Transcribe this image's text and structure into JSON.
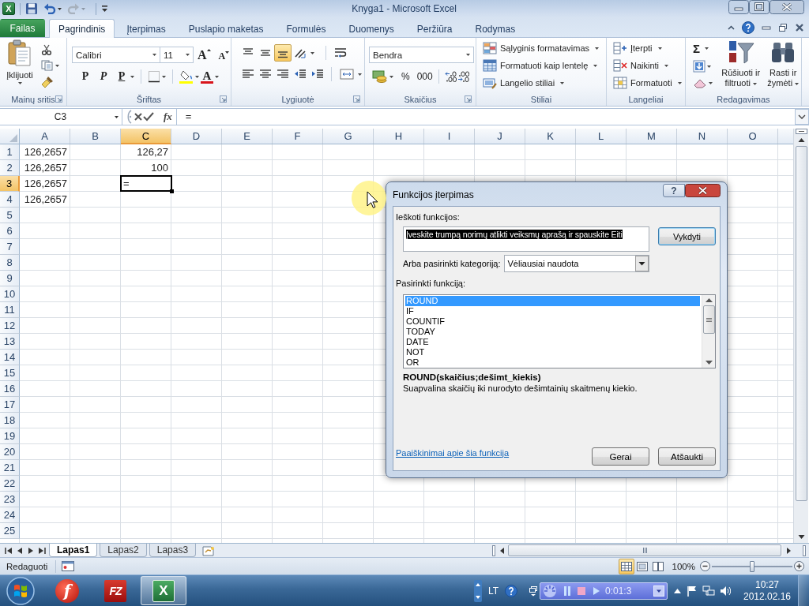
{
  "window": {
    "app_glyph": "X",
    "title": "Knyga1 - Microsoft Excel"
  },
  "quick_access": [
    {
      "kind": "save",
      "disabled": false
    },
    {
      "kind": "undo",
      "disabled": false
    },
    {
      "kind": "redo",
      "disabled": true
    }
  ],
  "ribbon_tabs": [
    {
      "label": "Failas",
      "kind": "file",
      "selected": false
    },
    {
      "label": "Pagrindinis",
      "kind": "tab",
      "selected": true
    },
    {
      "label": "Įterpimas",
      "kind": "tab",
      "selected": false
    },
    {
      "label": "Puslapio maketas",
      "kind": "tab",
      "selected": false
    },
    {
      "label": "Formulės",
      "kind": "tab",
      "selected": false
    },
    {
      "label": "Duomenys",
      "kind": "tab",
      "selected": false
    },
    {
      "label": "Peržiūra",
      "kind": "tab",
      "selected": false
    },
    {
      "label": "Rodymas",
      "kind": "tab",
      "selected": false
    }
  ],
  "ribbon": {
    "clipboard": {
      "label": "Mainų sritis",
      "paste": "Įklijuoti"
    },
    "font": {
      "label": "Šriftas",
      "font_name": "Calibri",
      "font_size": "11",
      "grow": "A",
      "shrink": "A",
      "styles": [
        {
          "label": "P",
          "kind": "bold"
        },
        {
          "label": "P",
          "kind": "italic"
        },
        {
          "label": "P",
          "kind": "underline"
        }
      ],
      "font_color": "A"
    },
    "alignment": {
      "label": "Lygiuotė",
      "vertical": [
        {
          "kind": "top",
          "selected": false
        },
        {
          "kind": "middle",
          "selected": false
        },
        {
          "kind": "bottom",
          "selected": true
        }
      ],
      "horizontal": [
        {
          "kind": "left",
          "selected": false
        },
        {
          "kind": "center",
          "selected": false
        },
        {
          "kind": "right",
          "selected": false
        }
      ]
    },
    "number": {
      "label": "Skaičius",
      "format": "Bendra",
      "percent": "%",
      "thousands": "000"
    },
    "styles": {
      "label": "Stiliai",
      "commands": [
        {
          "label": "Sąlyginis formatavimas",
          "kind": "conditional"
        },
        {
          "label": "Formatuoti kaip lentelę",
          "kind": "table"
        },
        {
          "label": "Langelio stiliai",
          "kind": "cell"
        }
      ]
    },
    "cells": {
      "label": "Langeliai",
      "commands": [
        {
          "label": "Įterpti",
          "kind": "insert"
        },
        {
          "label": "Naikinti",
          "kind": "delete"
        },
        {
          "label": "Formatuoti",
          "kind": "format"
        }
      ]
    },
    "editing": {
      "label": "Redagavimas",
      "sum": "Σ",
      "sort": "Rūšiuoti ir filtruoti",
      "find": "Rasti ir žymėti"
    }
  },
  "formula_bar": {
    "name_box": "C3",
    "insert_function": "fx",
    "formula": "="
  },
  "sheet": {
    "columns": [
      {
        "label": "A",
        "selected": false
      },
      {
        "label": "B",
        "selected": false
      },
      {
        "label": "C",
        "selected": true
      },
      {
        "label": "D",
        "selected": false
      },
      {
        "label": "E",
        "selected": false
      },
      {
        "label": "F",
        "selected": false
      },
      {
        "label": "G",
        "selected": false
      },
      {
        "label": "H",
        "selected": false
      },
      {
        "label": "I",
        "selected": false
      },
      {
        "label": "J",
        "selected": false
      },
      {
        "label": "K",
        "selected": false
      },
      {
        "label": "L",
        "selected": false
      },
      {
        "label": "M",
        "selected": false
      },
      {
        "label": "N",
        "selected": false
      },
      {
        "label": "O",
        "selected": false
      }
    ],
    "rows": [
      {
        "label": "1",
        "selected": false,
        "cells": [
          {
            "text": "126,2657",
            "kind": "number",
            "selected": false
          },
          null,
          {
            "text": "126,27",
            "kind": "number",
            "selected": false
          }
        ]
      },
      {
        "label": "2",
        "selected": false,
        "cells": [
          {
            "text": "126,2657",
            "kind": "number",
            "selected": false
          },
          null,
          {
            "text": "100",
            "kind": "number",
            "selected": false
          }
        ]
      },
      {
        "label": "3",
        "selected": true,
        "cells": [
          {
            "text": "126,2657",
            "kind": "number",
            "selected": false
          },
          null,
          {
            "text": "=",
            "kind": "editing",
            "selected": true
          }
        ]
      },
      {
        "label": "4",
        "selected": false,
        "cells": [
          {
            "text": "126,2657",
            "kind": "number",
            "selected": false
          }
        ]
      },
      {
        "label": "5",
        "selected": false
      },
      {
        "label": "6",
        "selected": false
      },
      {
        "label": "7",
        "selected": false
      },
      {
        "label": "8",
        "selected": false
      },
      {
        "label": "9",
        "selected": false
      },
      {
        "label": "10",
        "selected": false
      },
      {
        "label": "11",
        "selected": false
      },
      {
        "label": "12",
        "selected": false
      },
      {
        "label": "13",
        "selected": false
      },
      {
        "label": "14",
        "selected": false
      },
      {
        "label": "15",
        "selected": false
      },
      {
        "label": "16",
        "selected": false
      },
      {
        "label": "17",
        "selected": false
      },
      {
        "label": "18",
        "selected": false
      },
      {
        "label": "19",
        "selected": false
      },
      {
        "label": "20",
        "selected": false
      },
      {
        "label": "21",
        "selected": false
      },
      {
        "label": "22",
        "selected": false
      },
      {
        "label": "23",
        "selected": false
      },
      {
        "label": "24",
        "selected": false
      },
      {
        "label": "25",
        "selected": false
      }
    ]
  },
  "sheet_tabs": [
    {
      "label": "Lapas1",
      "selected": true
    },
    {
      "label": "Lapas2",
      "selected": false
    },
    {
      "label": "Lapas3",
      "selected": false
    }
  ],
  "status_bar": {
    "mode": "Redaguoti",
    "views": [
      {
        "kind": "normal",
        "selected": true
      },
      {
        "kind": "layout",
        "selected": false
      },
      {
        "kind": "break",
        "selected": false
      }
    ],
    "zoom": "100%",
    "zoom_slider": {
      "level": 0.5
    }
  },
  "dialog": {
    "title": "Funkcijos įterpimas",
    "help_button": "?",
    "search_label": "Ieškoti funkcijos:",
    "search": {
      "value": "Įveskite trumpą norimų atlikti veiksmų aprašą ir spauskite Eiti",
      "selected": true
    },
    "go_button": "Vykdyti",
    "category_label": "Arba pasirinkti kategoriją:",
    "category": "Vėliausiai naudota",
    "function_label": "Pasirinkti funkciją:",
    "functions": [
      {
        "label": "ROUND",
        "selected": true
      },
      {
        "label": "IF",
        "selected": false
      },
      {
        "label": "COUNTIF",
        "selected": false
      },
      {
        "label": "TODAY",
        "selected": false
      },
      {
        "label": "DATE",
        "selected": false
      },
      {
        "label": "NOT",
        "selected": false
      },
      {
        "label": "OR",
        "selected": false
      }
    ],
    "signature": "ROUND(skaičius;dešimt_kiekis)",
    "description": "Suapvalina skaičių iki nurodyto dešimtainių skaitmenų kiekio.",
    "help_link": "Paaiškinimai apie šia funkcija",
    "buttons": [
      "Gerai",
      "Atšaukti"
    ]
  },
  "taskbar": {
    "apps": [
      {
        "glyph": "f",
        "kind": "disc",
        "selected": false
      },
      {
        "glyph": "FZ",
        "kind": "tile",
        "selected": false
      },
      {
        "glyph": "X",
        "kind": "sheet",
        "selected": true
      }
    ],
    "language": "LT",
    "recorder_time": "0:01:3",
    "clock_time": "10:27",
    "clock_date": "2012.02.16"
  }
}
